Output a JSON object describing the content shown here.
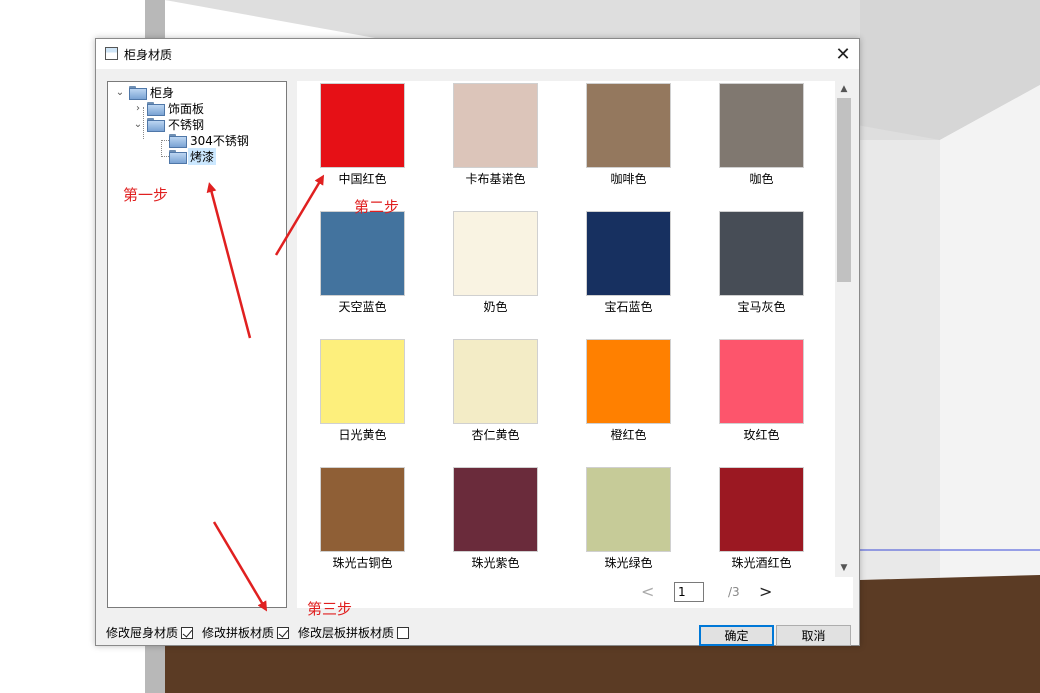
{
  "dialog": {
    "title": "柜身材质",
    "close_glyph": "✕"
  },
  "tree": {
    "root": "柜身",
    "items": [
      {
        "label": "饰面板",
        "expanded": false
      },
      {
        "label": "不锈钢",
        "expanded": true
      },
      {
        "label": "304不锈钢"
      },
      {
        "label": "烤漆",
        "selected": true
      }
    ]
  },
  "swatches": [
    {
      "name": "中国红色",
      "color": "#e61016"
    },
    {
      "name": "卡布基诺色",
      "color": "#dcc5ba"
    },
    {
      "name": "咖啡色",
      "color": "#94785e"
    },
    {
      "name": "咖色",
      "color": "#807870"
    },
    {
      "name": "天空蓝色",
      "color": "#43739e"
    },
    {
      "name": "奶色",
      "color": "#f9f3e2"
    },
    {
      "name": "宝石蓝色",
      "color": "#173060"
    },
    {
      "name": "宝马灰色",
      "color": "#474d56"
    },
    {
      "name": "日光黄色",
      "color": "#fdef7c"
    },
    {
      "name": "杏仁黄色",
      "color": "#f3ecc6"
    },
    {
      "name": "橙红色",
      "color": "#ff8000"
    },
    {
      "name": "玫红色",
      "color": "#fd556c"
    },
    {
      "name": "珠光古铜色",
      "color": "#8f5f36"
    },
    {
      "name": "珠光紫色",
      "color": "#6a2b3b"
    },
    {
      "name": "珠光绿色",
      "color": "#c6cb98"
    },
    {
      "name": "珠光酒红色",
      "color": "#9b1822"
    }
  ],
  "pager": {
    "prev_glyph": "<",
    "current": "1",
    "total": "/3",
    "next_glyph": ">"
  },
  "checks": [
    {
      "label": "修改屉身材质",
      "checked": true
    },
    {
      "label": "修改拼板材质",
      "checked": true
    },
    {
      "label": "修改层板拼板材质",
      "checked": false
    }
  ],
  "buttons": {
    "ok": "确定",
    "cancel": "取消"
  },
  "annotations": {
    "step1": "第一步",
    "step2": "第二步",
    "step3": "第三步"
  }
}
